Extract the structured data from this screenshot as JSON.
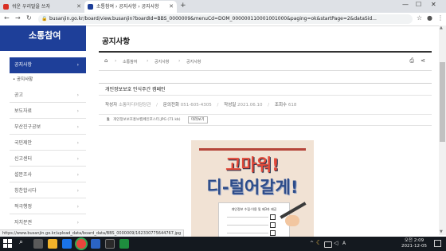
{
  "browser": {
    "tabs": [
      {
        "label": "쉬운 우리말을 쓰자",
        "active": false
      },
      {
        "label": "소통참여 › 공지사항 › 공지사항",
        "active": true
      }
    ],
    "new_tab_label": "+",
    "url": "busanjin.go.kr/board/view.busanjin?boardId=BBS_0000009&menuCd=DOM_000000110001001000&paging=ok&startPage=2&dataSid...",
    "status_url": "https://www.busanjin.go.kr/upload_data/board_data/BBS_0000009/162330775644767.jpg"
  },
  "sidebar": {
    "title": "소통참여",
    "active_item": "공지사항",
    "sub_item": "• 공지사항",
    "items": [
      "공고",
      "보도자료",
      "부산진구공보",
      "국민제안",
      "신고센터",
      "설문조사",
      "칭찬합시다",
      "적극행정",
      "자치분권"
    ]
  },
  "main": {
    "page_title": "공지사항",
    "breadcrumb": [
      "소통참여",
      "공지사항",
      "공지사항"
    ],
    "post_title": "개인정보보호 인식주간 캠페인",
    "meta": {
      "author_label": "작성자",
      "author": "소통미디어담당관",
      "contact_label": "문의전화",
      "contact": "051-605-4305",
      "date_label": "작성일",
      "date": "2021.06.10",
      "views_label": "조회수",
      "views": "618"
    },
    "attachment": {
      "filename": "개인정보보호홍보캠페인포스터.JPG (71 kb)",
      "preview_label": "미리보기"
    },
    "poster": {
      "line1": "고마워!",
      "line2": "디-털어갈게!",
      "card_title": "개인정보 수집·이용 및 제3자 제공",
      "colors": {
        "background": "#f1e2d4",
        "red": "#e24a3a",
        "navy": "#2d4c8a"
      }
    }
  },
  "taskbar": {
    "time": "오전 2:09",
    "date": "2021-12-05",
    "ime": "A"
  },
  "colors": {
    "brand": "#1e3f99",
    "taskbar": "#14191f"
  }
}
